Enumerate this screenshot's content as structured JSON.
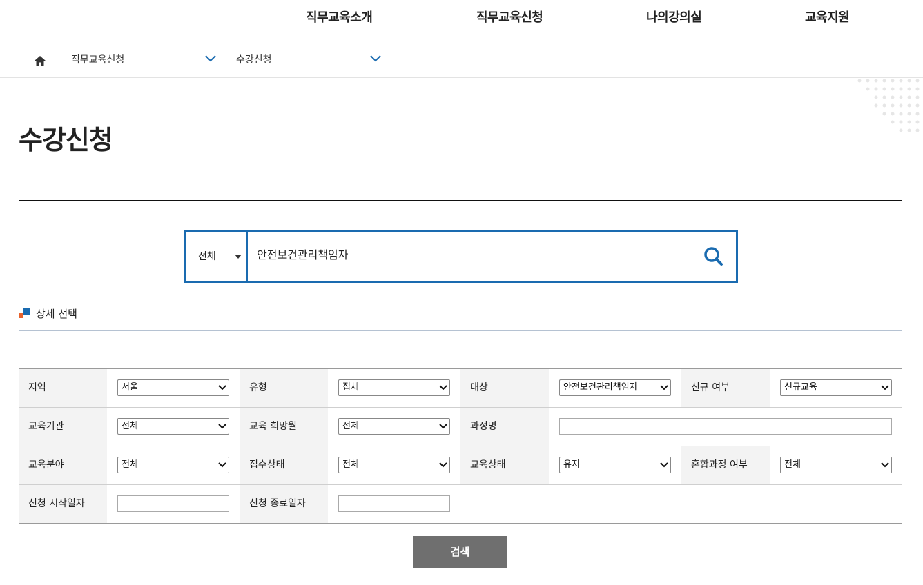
{
  "nav": {
    "items": [
      "직무교육소개",
      "직무교육신청",
      "나의강의실",
      "교육지원"
    ]
  },
  "breadcrumb": {
    "level1": "직무교육신청",
    "level2": "수강신청"
  },
  "page": {
    "title": "수강신청"
  },
  "search": {
    "category": "전체",
    "query": "안전보건관리책임자"
  },
  "detail": {
    "section_title": "상세 선택",
    "fields": {
      "region": {
        "label": "지역",
        "value": "서울"
      },
      "type": {
        "label": "유형",
        "value": "집체"
      },
      "target": {
        "label": "대상",
        "value": "안전보건관리책임자"
      },
      "new_status": {
        "label": "신규 여부",
        "value": "신규교육"
      },
      "institution": {
        "label": "교육기관",
        "value": "전체"
      },
      "month": {
        "label": "교육 희망월",
        "value": "전체"
      },
      "course_name": {
        "label": "과정명",
        "value": ""
      },
      "field": {
        "label": "교육분야",
        "value": "전체"
      },
      "reception": {
        "label": "접수상태",
        "value": "전체"
      },
      "edu_status": {
        "label": "교육상태",
        "value": "유지"
      },
      "blended": {
        "label": "혼합과정 여부",
        "value": "전체"
      },
      "start_date": {
        "label": "신청 시작일자",
        "value": ""
      },
      "end_date": {
        "label": "신청 종료일자",
        "value": ""
      }
    },
    "submit_label": "검색"
  },
  "colors": {
    "accent_blue": "#1a6bb0",
    "button_gray": "#6f6f6f",
    "mark_orange": "#e8622c",
    "mark_blue": "#1a6bb0"
  }
}
